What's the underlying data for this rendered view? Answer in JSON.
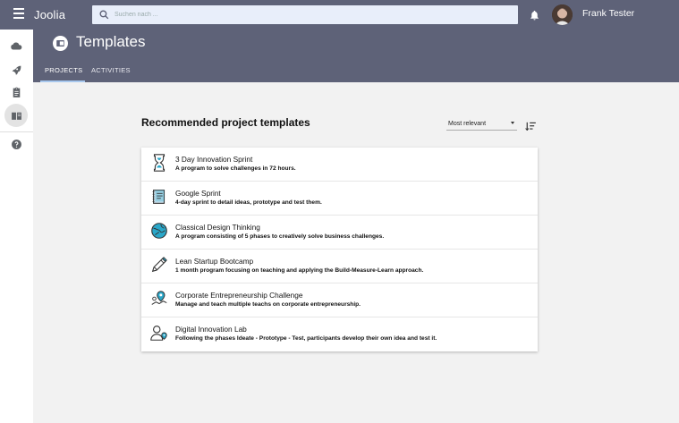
{
  "app": {
    "brand": "Joolia"
  },
  "search": {
    "placeholder": "Suchen nach ...",
    "value": ""
  },
  "user": {
    "name": "Frank Tester"
  },
  "header": {
    "title": "Templates",
    "tabs": [
      {
        "label": "PROJECTS",
        "active": true
      },
      {
        "label": "ACTIVITIES",
        "active": false
      }
    ]
  },
  "sidebar": {
    "items": [
      {
        "icon": "cloud-icon"
      },
      {
        "icon": "rocket-icon"
      },
      {
        "icon": "clipboard-icon"
      },
      {
        "icon": "book-icon",
        "active": true
      },
      {
        "icon": "help-icon"
      }
    ]
  },
  "main": {
    "section_title": "Recommended project templates",
    "sort": {
      "selected": "Most relevant"
    },
    "templates": [
      {
        "name": "3 Day Innovation Sprint",
        "description": "A program to solve challenges in 72 hours.",
        "icon": "hourglass-icon"
      },
      {
        "name": "Google Sprint",
        "description": "4-day sprint to detail ideas, prototype and test them.",
        "icon": "notebook-icon"
      },
      {
        "name": "Classical Design Thinking",
        "description": "A program consisting of 5 phases to creatively solve business challenges.",
        "icon": "globe-icon"
      },
      {
        "name": "Lean Startup Bootcamp",
        "description": "1 month program focusing on teaching and applying the Build-Measure-Learn approach.",
        "icon": "pencil-icon"
      },
      {
        "name": "Corporate Entrepreneurship Challenge",
        "description": "Manage and teach multiple teachs on corporate entrepreneurship.",
        "icon": "map-pin-icon"
      },
      {
        "name": "Digital Innovation Lab",
        "description": "Following the phases Ideate -  Prototype - Test, participants develop their own idea and test it.",
        "icon": "user-location-icon"
      }
    ]
  },
  "colors": {
    "topbar": "#5e6278",
    "tab_underline": "#a8c8ee",
    "accent": "#2aa7c9"
  }
}
